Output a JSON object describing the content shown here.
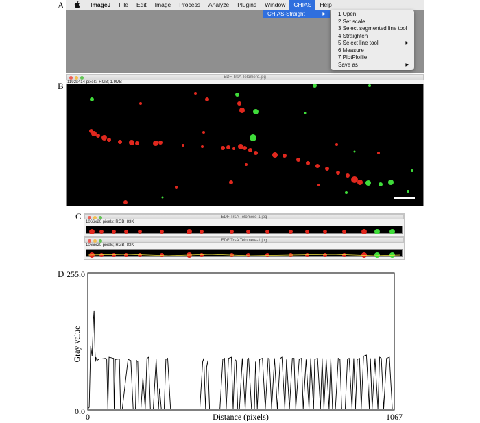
{
  "panels": {
    "a": "A",
    "b": "B",
    "c": "C",
    "d": "D"
  },
  "menubar": {
    "apple_icon": "apple-icon",
    "items": [
      "ImageJ",
      "File",
      "Edit",
      "Image",
      "Process",
      "Analyze",
      "Plugins",
      "Window",
      "CHIAS",
      "Help"
    ],
    "active": "CHIAS",
    "accent": "#2f6fde"
  },
  "submenu": {
    "label": "CHIAS-Straight",
    "arrow": "▶",
    "items": [
      {
        "label": "1 Open",
        "arrow": ""
      },
      {
        "label": "2 Set scale",
        "arrow": ""
      },
      {
        "label": "3 Select segmented line tool",
        "arrow": ""
      },
      {
        "label": "4 Straighten",
        "arrow": ""
      },
      {
        "label": "5 Select line tool",
        "arrow": "▶"
      },
      {
        "label": "6 Measure",
        "arrow": ""
      },
      {
        "label": "7 PlotPlofile",
        "arrow": ""
      },
      {
        "label": "Save as",
        "arrow": "▶"
      }
    ]
  },
  "window_b": {
    "title": "EDF TrsA Telomere.jpg",
    "info": "1192x414 pixels; RGB; 1.9MB"
  },
  "windows_c": [
    {
      "title": "EDF TrsA Telomere-1.jpg",
      "info": "1066x20 pixels; RGB; 83K"
    },
    {
      "title": "EDF TrsA Telomere-1.jpg",
      "info": "1066x20 pixels; RGB; 83K"
    }
  ],
  "colors": {
    "signal_red": "#e0281e",
    "signal_green": "#3fdc3a",
    "close": "#ec5f57",
    "minimize": "#f4bf4f",
    "zoom": "#61c454"
  },
  "chart_data": {
    "type": "line",
    "xlabel": "Distance (pixels)",
    "ylabel": "Gray value",
    "x_tick_labels": [
      "0",
      "1067"
    ],
    "y_tick_labels": [
      "0.0",
      "255.0"
    ],
    "xlim": [
      0,
      1067
    ],
    "ylim": [
      0,
      255
    ],
    "x": [
      0,
      5,
      10,
      15,
      20,
      22,
      24,
      25,
      27,
      28,
      32,
      40,
      50,
      62,
      66,
      70,
      74,
      90,
      92,
      96,
      110,
      114,
      120,
      140,
      150,
      158,
      166,
      170,
      174,
      178,
      185,
      192,
      200,
      206,
      212,
      218,
      228,
      238,
      246,
      250,
      256,
      262,
      266,
      272,
      278,
      288,
      296,
      305,
      310,
      315,
      320,
      326,
      332,
      336,
      340,
      350,
      370,
      390,
      400,
      404,
      410,
      414,
      418,
      424,
      430,
      440,
      460,
      470,
      476,
      482,
      490,
      500,
      506,
      512,
      516,
      522,
      528,
      538,
      548,
      556,
      560,
      570,
      580,
      584,
      590,
      598,
      608,
      618,
      628,
      632,
      640,
      650,
      660,
      670,
      676,
      686,
      692,
      702,
      712,
      718,
      724,
      736,
      744,
      750,
      760,
      770,
      776,
      786,
      790,
      800,
      810,
      816,
      822,
      830,
      840,
      846,
      852,
      862,
      872,
      878,
      884,
      896,
      904,
      910,
      920,
      926,
      932,
      938,
      946,
      952,
      960,
      970,
      980,
      984,
      990,
      1000,
      1010,
      1016,
      1022,
      1030,
      1040,
      1050,
      1060,
      1067
    ],
    "y": [
      2,
      5,
      120,
      100,
      170,
      185,
      130,
      110,
      90,
      98,
      92,
      95,
      95,
      96,
      95,
      2,
      98,
      96,
      2,
      94,
      95,
      2,
      2,
      94,
      92,
      2,
      2,
      92,
      90,
      2,
      2,
      60,
      2,
      96,
      98,
      2,
      2,
      95,
      2,
      40,
      2,
      2,
      2,
      94,
      96,
      2,
      2,
      2,
      2,
      2,
      2,
      2,
      2,
      2,
      2,
      2,
      2,
      2,
      90,
      96,
      2,
      80,
      92,
      2,
      2,
      2,
      2,
      94,
      96,
      2,
      96,
      98,
      2,
      94,
      92,
      2,
      2,
      96,
      2,
      94,
      96,
      2,
      2,
      90,
      2,
      94,
      96,
      2,
      96,
      94,
      2,
      96,
      2,
      96,
      98,
      2,
      94,
      2,
      96,
      96,
      2,
      94,
      96,
      2,
      94,
      2,
      96,
      2,
      94,
      96,
      2,
      96,
      2,
      94,
      2,
      96,
      2,
      2,
      96,
      94,
      2,
      2,
      94,
      96,
      2,
      96,
      2,
      94,
      96,
      2,
      100,
      102,
      2,
      96,
      2,
      96,
      2,
      98,
      96,
      2,
      96,
      98,
      2,
      2
    ]
  }
}
